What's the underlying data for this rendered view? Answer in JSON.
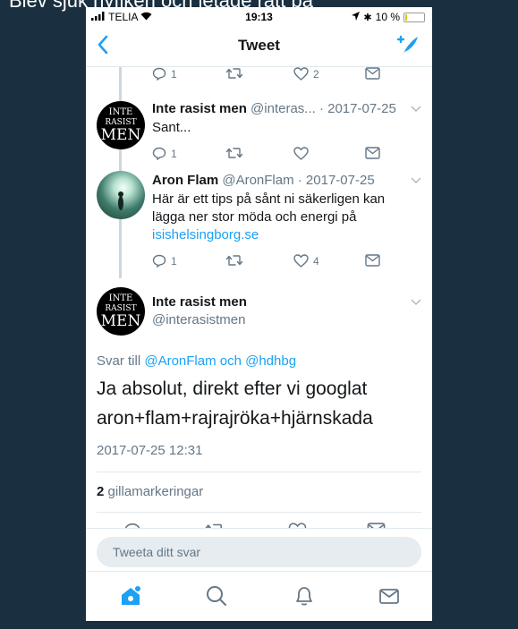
{
  "overlay": {
    "text": "Blev sjuk nyfiken och letade rätt på"
  },
  "status_bar": {
    "carrier": "TELIA",
    "time": "19:13",
    "battery": "10 %",
    "battery_level": 0.1
  },
  "header": {
    "title": "Tweet"
  },
  "top_actions": {
    "reply_count": "1",
    "like_count": "2"
  },
  "tweets": [
    {
      "name": "Inte rasist men",
      "meta": " @interas... · 2017-07-25",
      "text": "Sant...",
      "reply_count": "1"
    },
    {
      "name": "Aron Flam",
      "meta": " @AronFlam · 2017-07-25",
      "text": "Här är ett tips på sånt ni säkerligen kan lägga ner stor möda och energi på ",
      "link": "isishelsingborg.se",
      "reply_count": "1",
      "like_count": "4"
    }
  ],
  "main_tweet": {
    "name": "Inte rasist men",
    "handle": "@interasistmen",
    "reply_prefix": "Svar till ",
    "reply_to": "@AronFlam och @hdhbg",
    "text_line1": "Ja absolut, direkt efter vi googlat",
    "text_line2": "aron+flam+rajrajröka+hjärnskada",
    "timestamp": "2017-07-25 12:31",
    "likes_count": "2",
    "likes_label": " gillamarkeringar"
  },
  "avatar_text": {
    "line1": "INTE",
    "line2": "RASIST",
    "line3": "MEN"
  },
  "reply_box": {
    "placeholder": "Tweeta ditt svar"
  },
  "colors": {
    "accent": "#1da1f2",
    "background": "#1a3040",
    "secondary_text": "#657786"
  },
  "icons": [
    "back-chevron-icon",
    "compose-icon",
    "reply-icon",
    "retweet-icon",
    "like-icon",
    "dm-icon",
    "home-icon",
    "search-icon",
    "notifications-icon",
    "messages-icon"
  ]
}
